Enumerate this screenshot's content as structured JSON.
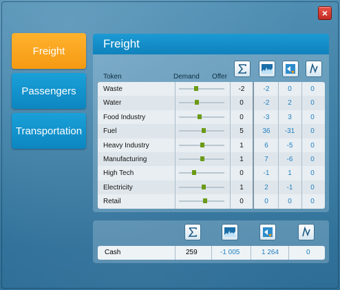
{
  "window": {
    "close_label": "×"
  },
  "tabs": [
    {
      "label": "Freight"
    },
    {
      "label": "Passengers"
    },
    {
      "label": "Transportation"
    }
  ],
  "panel": {
    "title": "Freight",
    "headers": {
      "token": "Token",
      "demand": "Demand",
      "offer": "Offer"
    },
    "icons": [
      "sum-icon",
      "chart-icon",
      "sound-icon",
      "trend-icon"
    ]
  },
  "rows": [
    {
      "token": "Waste",
      "level": 0.38,
      "v0": "-2",
      "v1": "-2",
      "v2": "0",
      "v3": "0"
    },
    {
      "token": "Water",
      "level": 0.4,
      "v0": "0",
      "v1": "-2",
      "v2": "2",
      "v3": "0"
    },
    {
      "token": "Food Industry",
      "level": 0.45,
      "v0": "0",
      "v1": "-3",
      "v2": "3",
      "v3": "0"
    },
    {
      "token": "Fuel",
      "level": 0.55,
      "v0": "5",
      "v1": "36",
      "v2": "-31",
      "v3": "0"
    },
    {
      "token": "Heavy Industry",
      "level": 0.52,
      "v0": "1",
      "v1": "6",
      "v2": "-5",
      "v3": "0"
    },
    {
      "token": "Manufacturing",
      "level": 0.52,
      "v0": "1",
      "v1": "7",
      "v2": "-6",
      "v3": "0"
    },
    {
      "token": "High Tech",
      "level": 0.33,
      "v0": "0",
      "v1": "-1",
      "v2": "1",
      "v3": "0"
    },
    {
      "token": "Electricity",
      "level": 0.55,
      "v0": "1",
      "v1": "2",
      "v2": "-1",
      "v3": "0"
    },
    {
      "token": "Retail",
      "level": 0.58,
      "v0": "0",
      "v1": "0",
      "v2": "0",
      "v3": "0"
    }
  ],
  "cash": {
    "label": "Cash",
    "v0": "259",
    "v1": "-1 005",
    "v2": "1 264",
    "v3": "0"
  },
  "colors": {
    "accent": "#f59a12",
    "tab_blue": "#0c86c1",
    "value_blue": "#1f7ec2",
    "knob": "#6b9a16"
  }
}
